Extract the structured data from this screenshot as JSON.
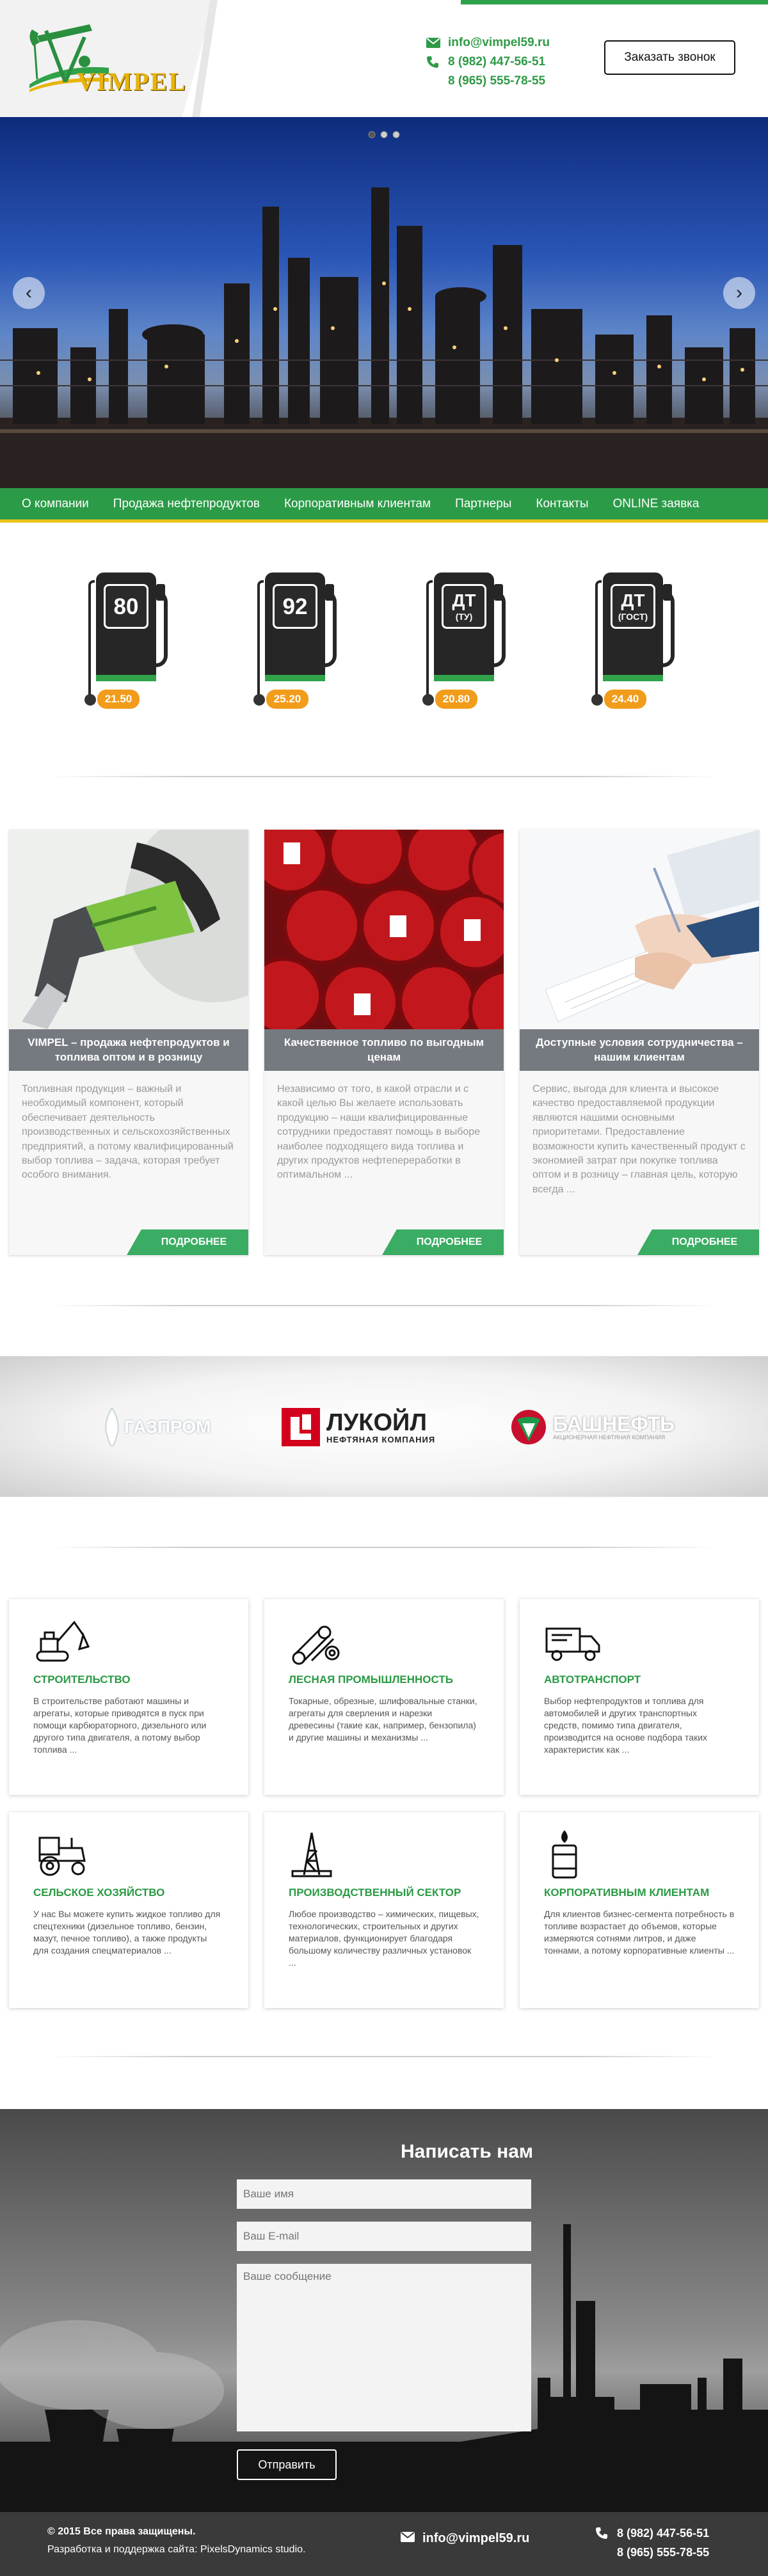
{
  "brand": {
    "name": "VIMPEL"
  },
  "header": {
    "email": "info@vimpel59.ru",
    "phone1": "8 (982) 447-56-51",
    "phone2": "8 (965) 555-78-55",
    "call_button": "Заказать звонок"
  },
  "slider": {
    "total_slides": 3,
    "active_slide": 1
  },
  "nav": {
    "items": [
      "О компании",
      "Продажа нефтепродуктов",
      "Корпоративным клиентам",
      "Партнеры",
      "Контакты",
      "ONLINE заявка"
    ]
  },
  "fuel": [
    {
      "label": "80",
      "sub": "",
      "price": "21.50"
    },
    {
      "label": "92",
      "sub": "",
      "price": "25.20"
    },
    {
      "label": "ДТ",
      "sub": "(ТУ)",
      "price": "20.80"
    },
    {
      "label": "ДТ",
      "sub": "(ГОСТ)",
      "price": "24.40"
    }
  ],
  "features": [
    {
      "title": "VIMPEL – продажа нефтепродуктов и топлива оптом и в розницу",
      "text": "Топливная продукция – важный и необходимый компонент, который обеспечивает деятельность производственных и сельскохозяйственных предприятий, а потому квалифицированный выбор топлива – задача, которая требует особого внимания.",
      "more": "ПОДРОБНЕЕ"
    },
    {
      "title": "Качественное топливо по выгодным ценам",
      "text": "Независимо от того, в какой отрасли и с какой целью Вы желаете использовать продукцию – наши квалифицированные сотрудники предоставят помощь в выборе наиболее подходящего вида топлива и других продуктов нефтепереработки в оптимальном ...",
      "more": "ПОДРОБНЕЕ"
    },
    {
      "title": "Доступные условия сотрудничества – нашим клиентам",
      "text": "Сервис, выгода для клиента и высокое качество предоставляемой продукции являются нашими основными приоритетами. Предоставление возможности купить качественный продукт с экономией затрат при покупке топлива оптом и в розницу – главная цель, которую всегда ...",
      "more": "ПОДРОБНЕЕ"
    }
  ],
  "partners": [
    {
      "name": "ГАЗПРОМ"
    },
    {
      "name": "ЛУКОЙЛ",
      "sub": "НЕФТЯНАЯ КОМПАНИЯ"
    },
    {
      "name": "БАШНЕФТЬ",
      "sub": "АКЦИОНЕРНАЯ НЕФТЯНАЯ КОМПАНИЯ"
    }
  ],
  "sectors": [
    {
      "title": "СТРОИТЕЛЬСТВО",
      "text": "В строительстве работают машины и агрегаты, которые приводятся в пуск при помощи карбюраторного, дизельного или другого типа двигателя, а потому выбор топлива ...",
      "icon": "excavator-icon"
    },
    {
      "title": "ЛЕСНАЯ ПРОМЫШЛЕННОСТЬ",
      "text": "Токарные, обрезные, шлифовальные станки, агрегаты для сверления и нарезки древесины (такие как, например, бензопила) и другие машины и механизмы ...",
      "icon": "logs-icon"
    },
    {
      "title": "АВТОТРАНСПОРТ",
      "text": "Выбор нефтепродуктов и топлива для автомобилей и других транспортных средств, помимо типа двигателя, производится на основе подбора таких характеристик как ...",
      "icon": "truck-icon"
    },
    {
      "title": "СЕЛЬСКОЕ ХОЗЯЙСТВО",
      "text": "У нас Вы можете купить жидкое топливо для спецтехники (дизельное топливо, бензин, мазут, печное топливо), а также продукты для создания спецматериалов ...",
      "icon": "tractor-icon"
    },
    {
      "title": "ПРОИЗВОДСТВЕННЫЙ СЕКТОР",
      "text": "Любое производство – химических, пищевых, технологических, строительных и других материалов, функционирует благодаря большому количеству различных установок ...",
      "icon": "oil-rig-icon"
    },
    {
      "title": "КОРПОРАТИВНЫМ КЛИЕНТАМ",
      "text": "Для клиентов бизнес-сегмента потребность в топливе возрастает до объемов, которые измеряются сотнями литров, и даже тоннами, а потому корпоративные клиенты ...",
      "icon": "barrel-icon"
    }
  ],
  "contact": {
    "heading": "Написать нам",
    "name_placeholder": "Ваше имя",
    "email_placeholder": "Ваш E-mail",
    "message_placeholder": "Ваше сообщение",
    "send": "Отправить"
  },
  "footer": {
    "copyright": "© 2015 Все права защищены.",
    "developer": "Разработка и поддержка сайта: PixelsDynamics studio.",
    "email": "info@vimpel59.ru",
    "phone1": "8 (982) 447-56-51",
    "phone2": "8 (965) 555-78-55"
  },
  "colors": {
    "brand_green": "#2b9b48",
    "accent_yellow": "#e9c31b",
    "price_orange": "#f29c1b",
    "card_title_gray": "#757a80",
    "footer_dark": "#3a3a3a"
  }
}
